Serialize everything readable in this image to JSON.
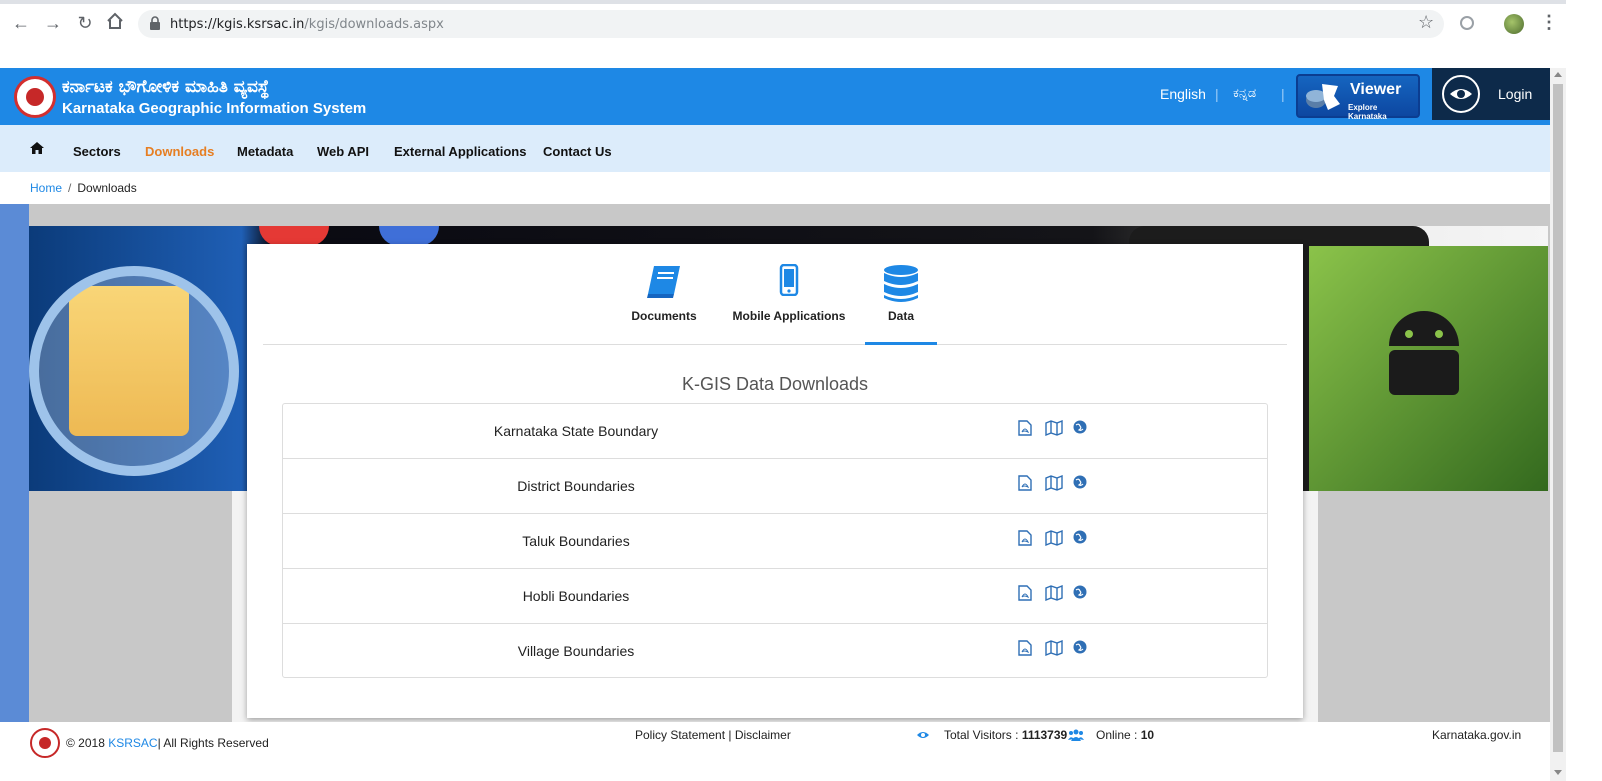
{
  "browser": {
    "url_host": "https://kgis.ksrsac.in",
    "url_path": "/kgis/downloads.aspx"
  },
  "header": {
    "title_kn": "ಕರ್ನಾಟಕ ಭೌಗೋಳಿಕ ಮಾಹಿತಿ ವ್ಯವಸ್ಥೆ",
    "title_en": "Karnataka Geographic Information System",
    "lang_en": "English",
    "lang_kn": "ಕನ್ನಡ",
    "viewer_title": "Viewer",
    "viewer_sub": "Explore Karnataka",
    "login": "Login"
  },
  "nav": {
    "items": [
      "Sectors",
      "Downloads",
      "Metadata",
      "Web API",
      "External Applications",
      "Contact Us"
    ],
    "active": "Downloads"
  },
  "breadcrumb": {
    "home": "Home",
    "separator": "/",
    "current": "Downloads"
  },
  "tabs": [
    {
      "label": "Documents",
      "icon": "book-icon"
    },
    {
      "label": "Mobile Applications",
      "icon": "mobile-icon"
    },
    {
      "label": "Data",
      "icon": "database-icon",
      "active": true
    }
  ],
  "panel": {
    "title": "K-GIS Data Downloads",
    "rows": [
      {
        "name": "Karnataka State Boundary"
      },
      {
        "name": "District Boundaries"
      },
      {
        "name": "Taluk Boundaries"
      },
      {
        "name": "Hobli Boundaries"
      },
      {
        "name": "Village Boundaries"
      }
    ],
    "row_icons": [
      "pdf-icon",
      "map-icon",
      "globe-icon"
    ]
  },
  "footer": {
    "copyright_prefix": "© 2018 ",
    "copyright_org": "KSRSAC",
    "copyright_suffix": "| All Rights Reserved",
    "policy": "Policy Statement | Disclaimer",
    "visitors_label": "Total Visitors : ",
    "visitors_count": "1113739",
    "online_label": "Online : ",
    "online_count": "10",
    "gov_link": "Karnataka.gov.in"
  },
  "colors": {
    "header_blue": "#1e88e5",
    "nav_bg": "#dcecfb",
    "active_nav": "#e67e22",
    "login_bg": "#0d2a4a"
  }
}
